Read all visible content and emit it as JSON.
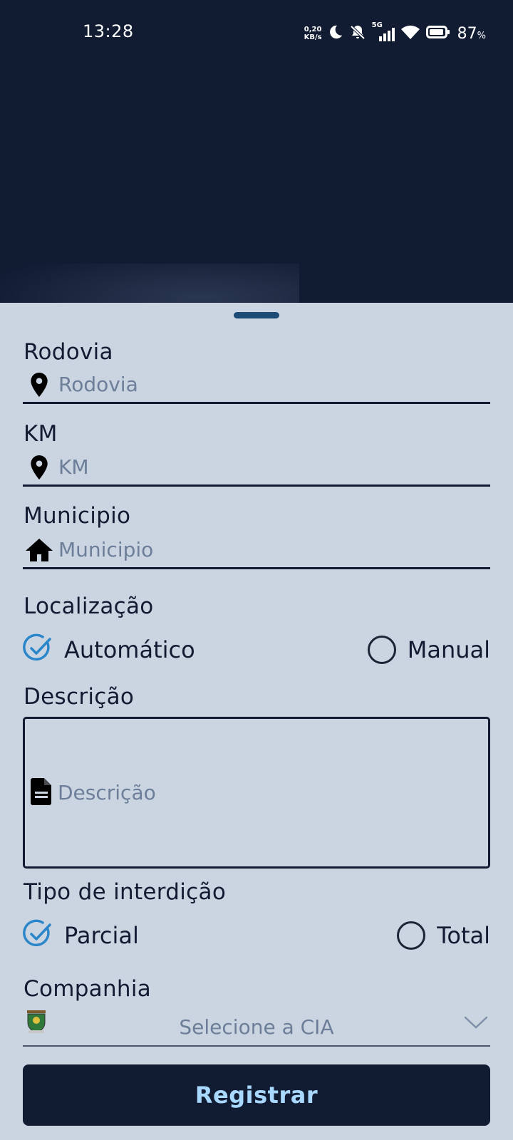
{
  "status_bar": {
    "time": "13:28",
    "net_speed_value": "0,20",
    "net_speed_unit": "KB/s",
    "network_type": "5G",
    "battery_percent": "87",
    "battery_unit": "%"
  },
  "form": {
    "rodovia": {
      "label": "Rodovia",
      "placeholder": "Rodovia",
      "icon": "location-pin-icon"
    },
    "km": {
      "label": "KM",
      "placeholder": "KM",
      "icon": "location-pin-icon"
    },
    "municipio": {
      "label": "Municipio",
      "placeholder": "Municipio",
      "icon": "home-icon"
    },
    "localizacao": {
      "label": "Localização",
      "options": [
        {
          "label": "Automático",
          "selected": true
        },
        {
          "label": "Manual",
          "selected": false
        }
      ]
    },
    "descricao": {
      "label": "Descrição",
      "placeholder": "Descrição",
      "icon": "document-icon"
    },
    "tipo_interdicao": {
      "label": "Tipo de interdição",
      "options": [
        {
          "label": "Parcial",
          "selected": true
        },
        {
          "label": "Total",
          "selected": false
        }
      ]
    },
    "companhia": {
      "label": "Companhia",
      "placeholder": "Selecione a CIA",
      "icon": "emblem-icon"
    },
    "submit_label": "Registrar"
  },
  "colors": {
    "header_bg": "#111c33",
    "sheet_bg": "#cbd5e2",
    "accent_blue": "#2a86c9",
    "button_text": "#a9d8ff",
    "placeholder": "#6c7e98"
  }
}
